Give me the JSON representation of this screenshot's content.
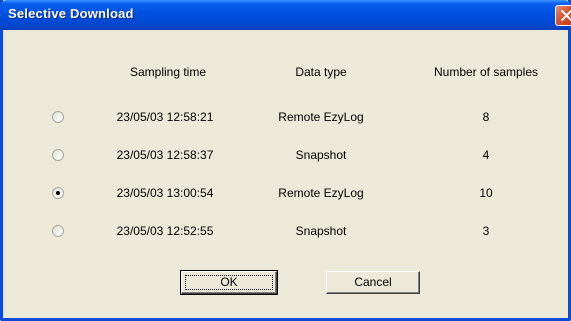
{
  "window": {
    "title": "Selective Download"
  },
  "columns": [
    "Sampling time",
    "Data type",
    "Number of samples"
  ],
  "rows": [
    {
      "time": "23/05/03 12:58:21",
      "type": "Remote EzyLog",
      "samples": "8",
      "selected": false
    },
    {
      "time": "23/05/03 12:58:37",
      "type": "Snapshot",
      "samples": "4",
      "selected": false
    },
    {
      "time": "23/05/03 13:00:54",
      "type": "Remote EzyLog",
      "samples": "10",
      "selected": true
    },
    {
      "time": "23/05/03 12:52:55",
      "type": "Snapshot",
      "samples": "3",
      "selected": false
    }
  ],
  "buttons": {
    "ok": "OK",
    "cancel": "Cancel"
  },
  "colors": {
    "titlebar": "#0055e5",
    "dialog_bg": "#ece9d8",
    "close_button": "#d8522e"
  },
  "icons": {
    "close": "close-icon"
  }
}
